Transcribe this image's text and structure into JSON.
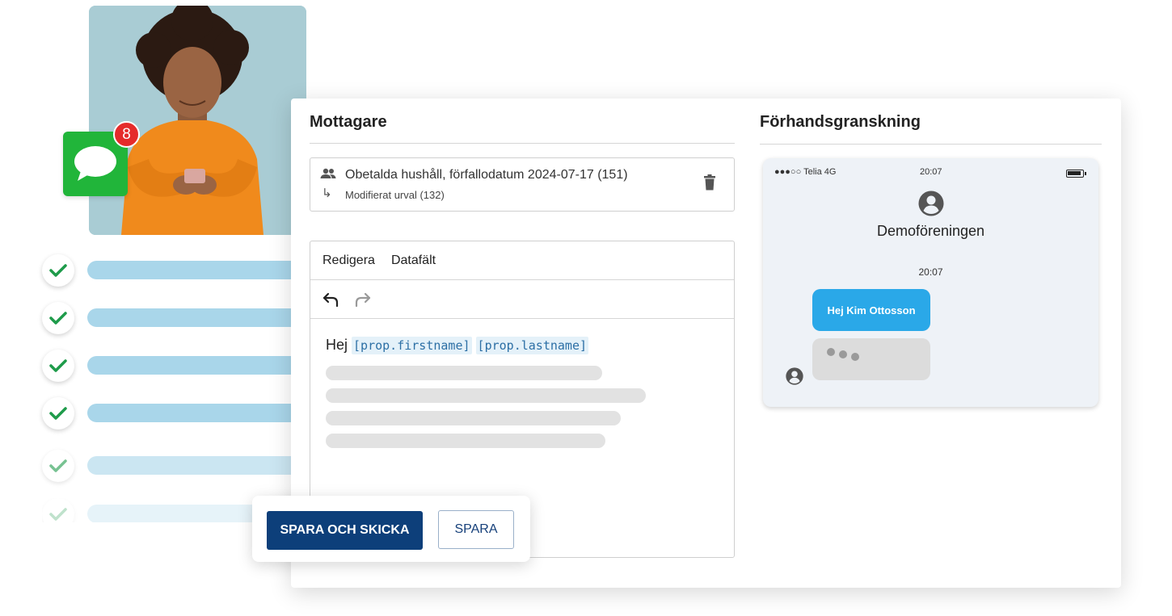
{
  "notification": {
    "count": "8"
  },
  "recipients_section": {
    "title": "Mottagare"
  },
  "recipients": {
    "selection": "Obetalda hushåll, förfallodatum 2024-07-17 (151)",
    "modified": "Modifierat urval (132)"
  },
  "editor": {
    "tabs": [
      "Redigera",
      "Datafält"
    ],
    "greeting": "Hej",
    "fields": [
      "[prop.firstname]",
      "[prop.lastname]"
    ]
  },
  "preview": {
    "title": "Förhandsgranskning",
    "carrier": "●●●○○ Telia 4G",
    "status_time": "20:07",
    "sender": "Demoföreningen",
    "message_time": "20:07",
    "message": "Hej Kim Ottosson"
  },
  "actions": {
    "save_and_send": "SPARA OCH SKICKA",
    "save": "SPARA"
  },
  "colors": {
    "primary": "#0d3f7a",
    "bubble": "#2aa8e8",
    "check": "#1e9b4a",
    "badge": "#e52b2b",
    "messages_app": "#21b53a"
  }
}
